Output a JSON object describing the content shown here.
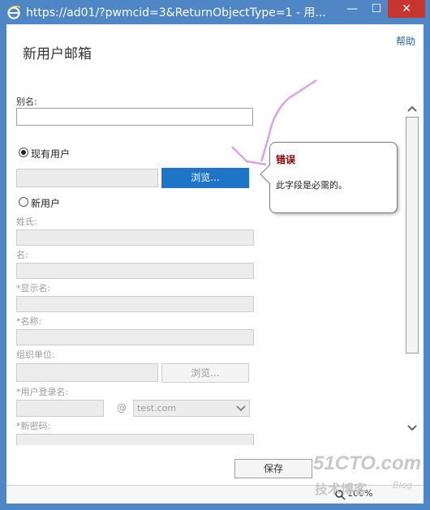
{
  "window": {
    "title": "https://ad01/?pwmcid=3&ReturnObjectType=1 - 用...",
    "min_label": "—",
    "max_label": "☐",
    "close_label": "✕"
  },
  "header": {
    "help": "帮助",
    "title": "新用户邮箱"
  },
  "form": {
    "alias_label": "别名:",
    "alias_value": "",
    "existing_user_label": "现有用户",
    "browse_label": "浏览...",
    "new_user_label": "新用户",
    "surname_label": "姓氏:",
    "given_name_label": "名:",
    "display_name_label": "*显示名:",
    "name_label": "*名称:",
    "ou_label": "组织单位:",
    "ou_browse_label": "浏览...",
    "logon_label": "*用户登录名:",
    "at_sign": "@",
    "domain_value": "test.com",
    "password_label": "*新密码:"
  },
  "callout": {
    "title": "错误",
    "message": "此字段是必需的。"
  },
  "footer": {
    "save_label": "保存",
    "zoom": "100%"
  },
  "watermark": {
    "main": "51CTO.com",
    "sub": "技术博客",
    "blog": "Blog"
  },
  "colors": {
    "accent": "#1e74c6",
    "titlebar": "#4f86c6",
    "close": "#c7362e",
    "error_title": "#8b0000"
  }
}
